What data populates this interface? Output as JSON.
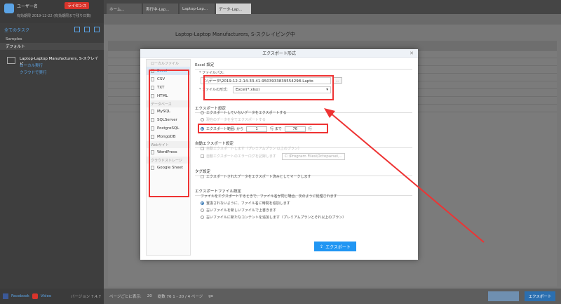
{
  "sidebar": {
    "user": "ユーザー名",
    "badge": "ライセンス",
    "info": "有効期限 2019-12-22 (有効期限まで残り日数)",
    "tasks_header": "全てのタスク",
    "samples": "Samples",
    "default": "デフォルト",
    "task_name": "Laptop-Laptop Manufacturers, S-スクレイピ...",
    "task_status": "ローカル実行",
    "task_link": "クラウドで実行",
    "facebook": "Facebook",
    "video": "Video",
    "version": "バージョン 7.4.7"
  },
  "tabs": [
    {
      "label": "ホーム..."
    },
    {
      "label": "実行中-Lap..."
    },
    {
      "label": "Laptop-Lap..."
    },
    {
      "label": "データ-Lap..."
    }
  ],
  "page_title": "Laptop-Laptop Manufacturers, S-スクレイピング中",
  "dialog": {
    "title": "エクスポート形式",
    "close": "✕",
    "left_title": "ローカルファイル",
    "formats": [
      "Excel",
      "CSV",
      "TXT",
      "HTML"
    ],
    "db_title": "データベース",
    "dbs": [
      "MySQL",
      "SQLServer",
      "PostgreSQL",
      "MongoDB"
    ],
    "web_title": "Webサイト",
    "webs": [
      "WordPress"
    ],
    "cloud_title": "クラウドストレージ",
    "clouds": [
      "Google Sheet"
    ],
    "excel_settings": "Excel 設定",
    "file_path_label": "* ファイルパス:",
    "file_path": "C:\\データ\\2019-12-2-14-33-41-9503933839554298-Lapto",
    "dots": "...",
    "file_type_label": "* ファイルの形式:",
    "file_type": "Excel(*.xlsx)",
    "export_settings": "エクスポート設定",
    "opt_unexported": "エクスポートしていないデータをエクスポートする",
    "opt_all": "現在のデータを全てエクスポートする",
    "opt_range": "エクスポート範囲: から",
    "range_from": "1",
    "range_mid": "行 まで",
    "range_to": "76",
    "range_end": "行",
    "auto_title": "自動エクスポート設定",
    "auto1": "自動エクスポートします（プレミアムプラン 以上のプラン）",
    "auto2": "自動エクスポートのエラーログを記録します",
    "auto_path": "C:\\Program Files\\Octoparse\\...",
    "tag_title": "タグ設定",
    "tag1": "エクスポートされたデータをエクスポート済みとしてマークします",
    "file_title": "エクスポートファイル設定",
    "file_desc": "ファイルをエクスポートするときで、ファイル名が同じ場合、次のように処理されます",
    "file_opt1": "置換されないように、ファイル名に時間を追加します",
    "file_opt2": "古いファイルを新しいファイルで上書きます",
    "file_opt3": "古いファイルに新たなコンテントを追加します（プレミアムプランとそれ以上のプラン）",
    "export_button": "エクスポート"
  },
  "footer": {
    "per_page": "ページごとに表示:",
    "per_page_val": "20",
    "total": "総数 76    1 - 20 / 4 ページ",
    "go": "go",
    "export": "エクスポート"
  },
  "colors": {
    "accent": "#2196f3",
    "highlight": "#ee3333"
  }
}
